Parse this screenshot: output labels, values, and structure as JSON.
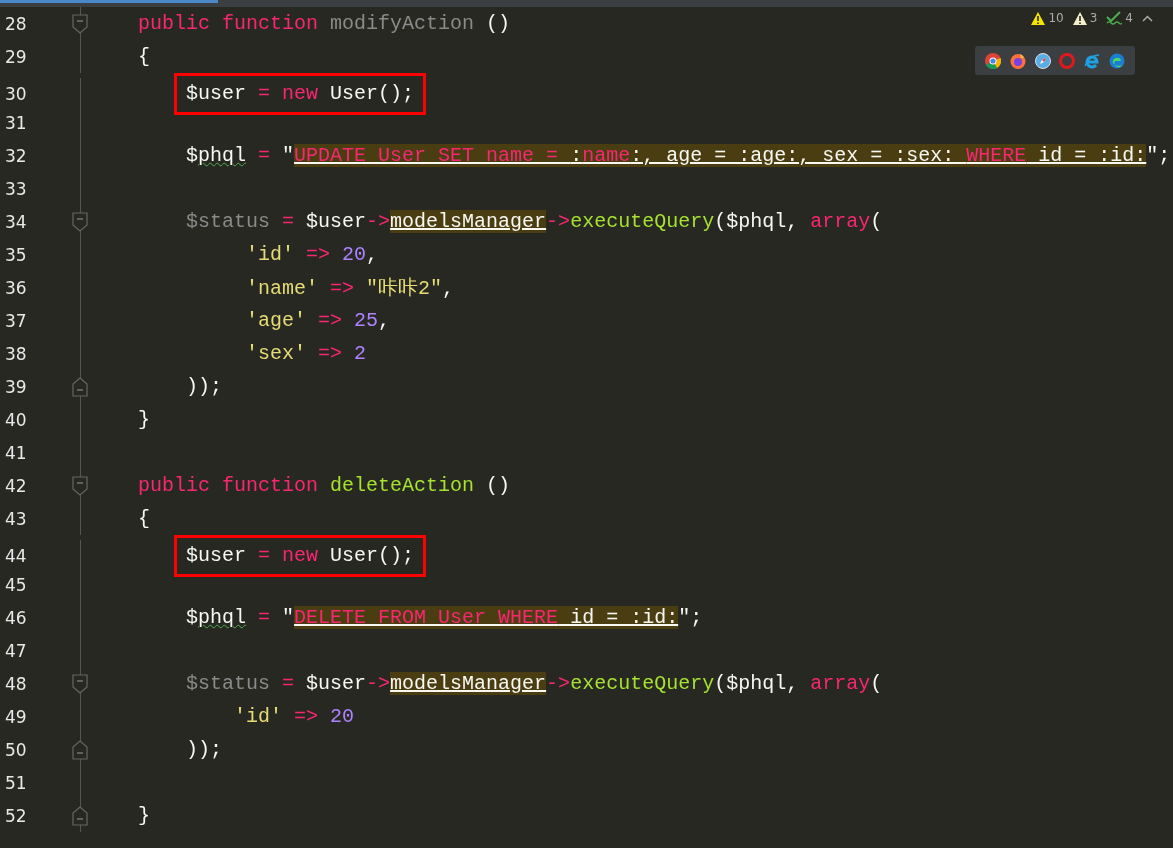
{
  "inspections": [
    {
      "kind": "warning",
      "count": "10"
    },
    {
      "kind": "weak-warning",
      "count": "3"
    },
    {
      "kind": "typo",
      "count": "4"
    }
  ],
  "browsers": [
    {
      "kind": "chrome"
    },
    {
      "kind": "firefox"
    },
    {
      "kind": "safari"
    },
    {
      "kind": "opera"
    },
    {
      "kind": "ie"
    },
    {
      "kind": "edge"
    }
  ],
  "lines": [
    {
      "number": "28",
      "kind": "fold-start",
      "boxed": false,
      "tokens": [
        {
          "kind": "keyword",
          "text": "public function "
        },
        {
          "kind": "unused",
          "text": "modifyAction"
        },
        {
          "kind": "plain",
          "text": " ()"
        }
      ]
    },
    {
      "number": "29",
      "kind": "plain",
      "boxed": false,
      "tokens": [
        {
          "kind": "plain",
          "text": "{"
        }
      ]
    },
    {
      "number": "30",
      "kind": "plain",
      "boxed": true,
      "tokens": [
        {
          "kind": "plain",
          "text": "    $user "
        },
        {
          "kind": "keyword",
          "text": "= new"
        },
        {
          "kind": "plain",
          "text": " User();"
        }
      ]
    },
    {
      "number": "31",
      "kind": "plain",
      "boxed": false
    },
    {
      "number": "32",
      "kind": "plain",
      "boxed": false,
      "tokens": [
        {
          "kind": "plain",
          "text": "    $"
        },
        {
          "kind": "typo",
          "text": "phql"
        },
        {
          "kind": "keyword",
          "text": " = "
        },
        {
          "kind": "plain",
          "text": "\""
        },
        {
          "kind": "sql-keyword",
          "text": "UPDATE User SET name = "
        },
        {
          "kind": "sql",
          "text": ":"
        },
        {
          "kind": "sql-keyword",
          "text": "name"
        },
        {
          "kind": "sql",
          "text": ":, age = :age:, sex = :sex: "
        },
        {
          "kind": "sql-keyword",
          "text": "WHERE"
        },
        {
          "kind": "sql",
          "text": " id = :id:"
        },
        {
          "kind": "plain",
          "text": "\";"
        }
      ]
    },
    {
      "number": "33",
      "kind": "plain",
      "boxed": false
    },
    {
      "number": "34",
      "kind": "fold-start",
      "boxed": false,
      "tokens": [
        {
          "kind": "unused",
          "text": "    $status"
        },
        {
          "kind": "keyword",
          "text": " = "
        },
        {
          "kind": "plain",
          "text": "$user"
        },
        {
          "kind": "keyword",
          "text": "->"
        },
        {
          "kind": "field",
          "text": "modelsManager"
        },
        {
          "kind": "keyword",
          "text": "->"
        },
        {
          "kind": "function",
          "text": "executeQuery"
        },
        {
          "kind": "plain",
          "text": "($phql, "
        },
        {
          "kind": "keyword",
          "text": "array"
        },
        {
          "kind": "plain",
          "text": "("
        }
      ]
    },
    {
      "number": "35",
      "kind": "plain",
      "boxed": false,
      "tokens": [
        {
          "kind": "string",
          "text": "         'id'"
        },
        {
          "kind": "keyword",
          "text": " => "
        },
        {
          "kind": "number",
          "text": "20"
        },
        {
          "kind": "plain",
          "text": ","
        }
      ]
    },
    {
      "number": "36",
      "kind": "plain",
      "boxed": false,
      "tokens": [
        {
          "kind": "string",
          "text": "         'name'"
        },
        {
          "kind": "keyword",
          "text": " => "
        },
        {
          "kind": "string",
          "text": "\"咔咔2\""
        },
        {
          "kind": "plain",
          "text": ","
        }
      ]
    },
    {
      "number": "37",
      "kind": "plain",
      "boxed": false,
      "tokens": [
        {
          "kind": "string",
          "text": "         'age'"
        },
        {
          "kind": "keyword",
          "text": " => "
        },
        {
          "kind": "number",
          "text": "25"
        },
        {
          "kind": "plain",
          "text": ","
        }
      ]
    },
    {
      "number": "38",
      "kind": "plain",
      "boxed": false,
      "tokens": [
        {
          "kind": "string",
          "text": "         'sex'"
        },
        {
          "kind": "keyword",
          "text": " => "
        },
        {
          "kind": "number",
          "text": "2"
        }
      ]
    },
    {
      "number": "39",
      "kind": "fold-end",
      "boxed": false,
      "tokens": [
        {
          "kind": "plain",
          "text": "    ));"
        }
      ]
    },
    {
      "number": "40",
      "kind": "plain",
      "boxed": false,
      "tokens": [
        {
          "kind": "plain",
          "text": "}"
        }
      ]
    },
    {
      "number": "41",
      "kind": "plain",
      "boxed": false
    },
    {
      "number": "42",
      "kind": "fold-start",
      "boxed": false,
      "tokens": [
        {
          "kind": "keyword",
          "text": "public function "
        },
        {
          "kind": "function",
          "text": "deleteAction"
        },
        {
          "kind": "plain",
          "text": " ()"
        }
      ]
    },
    {
      "number": "43",
      "kind": "plain",
      "boxed": false,
      "tokens": [
        {
          "kind": "plain",
          "text": "{"
        }
      ]
    },
    {
      "number": "44",
      "kind": "plain",
      "boxed": true,
      "tokens": [
        {
          "kind": "plain",
          "text": "    $user "
        },
        {
          "kind": "keyword",
          "text": "= new"
        },
        {
          "kind": "plain",
          "text": " User();"
        }
      ]
    },
    {
      "number": "45",
      "kind": "plain",
      "boxed": false
    },
    {
      "number": "46",
      "kind": "plain",
      "boxed": false,
      "tokens": [
        {
          "kind": "plain",
          "text": "    $"
        },
        {
          "kind": "typo",
          "text": "phql"
        },
        {
          "kind": "keyword",
          "text": " = "
        },
        {
          "kind": "plain",
          "text": "\""
        },
        {
          "kind": "sql-keyword",
          "text": "DELETE FROM User WHERE"
        },
        {
          "kind": "sql",
          "text": " id = :id:"
        },
        {
          "kind": "plain",
          "text": "\";"
        }
      ]
    },
    {
      "number": "47",
      "kind": "plain",
      "boxed": false
    },
    {
      "number": "48",
      "kind": "fold-start",
      "boxed": false,
      "tokens": [
        {
          "kind": "unused",
          "text": "    $status"
        },
        {
          "kind": "keyword",
          "text": " = "
        },
        {
          "kind": "plain",
          "text": "$user"
        },
        {
          "kind": "keyword",
          "text": "->"
        },
        {
          "kind": "field",
          "text": "modelsManager"
        },
        {
          "kind": "keyword",
          "text": "->"
        },
        {
          "kind": "function",
          "text": "executeQuery"
        },
        {
          "kind": "plain",
          "text": "($phql, "
        },
        {
          "kind": "keyword",
          "text": "array"
        },
        {
          "kind": "plain",
          "text": "("
        }
      ]
    },
    {
      "number": "49",
      "kind": "plain",
      "boxed": false,
      "tokens": [
        {
          "kind": "string",
          "text": "        'id'"
        },
        {
          "kind": "keyword",
          "text": " => "
        },
        {
          "kind": "number",
          "text": "20"
        }
      ]
    },
    {
      "number": "50",
      "kind": "fold-end",
      "boxed": false,
      "tokens": [
        {
          "kind": "plain",
          "text": "    ));"
        }
      ]
    },
    {
      "number": "51",
      "kind": "plain",
      "boxed": false
    },
    {
      "number": "52",
      "kind": "fold-end",
      "boxed": false,
      "tokens": [
        {
          "kind": "plain",
          "text": "}"
        }
      ]
    }
  ]
}
